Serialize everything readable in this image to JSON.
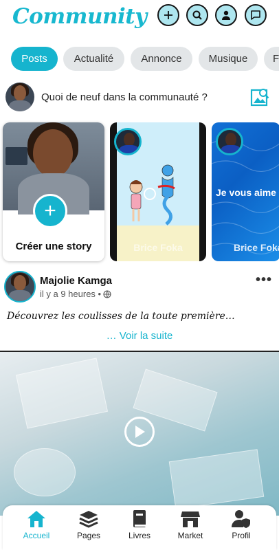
{
  "app": {
    "title": "Community",
    "accent": "#16b4ce"
  },
  "header": {
    "icons": [
      "plus-icon",
      "search-icon",
      "user-icon",
      "chat-icon"
    ]
  },
  "tabs": [
    {
      "label": "Posts",
      "active": true
    },
    {
      "label": "Actualité",
      "active": false
    },
    {
      "label": "Annonce",
      "active": false
    },
    {
      "label": "Musique",
      "active": false
    },
    {
      "label": "F",
      "active": false
    }
  ],
  "composer": {
    "placeholder": "Quoi de neuf dans la communauté ?"
  },
  "stories": {
    "create_label": "Créer une story",
    "items": [
      {
        "name": "Brice Foka"
      },
      {
        "name": "Brice Foka",
        "caption": "Je vous aime"
      }
    ]
  },
  "post": {
    "author": "Majolie Kamga",
    "time": "il y a 9 heures •",
    "text": "Découvrez les coulisses de la toute première…",
    "read_more": "… Voir la suite"
  },
  "bottom_nav": [
    {
      "label": "Accueil",
      "icon": "home-icon",
      "active": true
    },
    {
      "label": "Pages",
      "icon": "layers-icon",
      "active": false
    },
    {
      "label": "Livres",
      "icon": "book-icon",
      "active": false
    },
    {
      "label": "Market",
      "icon": "store-icon",
      "active": false
    },
    {
      "label": "Profil",
      "icon": "profile-shield-icon",
      "active": false
    }
  ]
}
